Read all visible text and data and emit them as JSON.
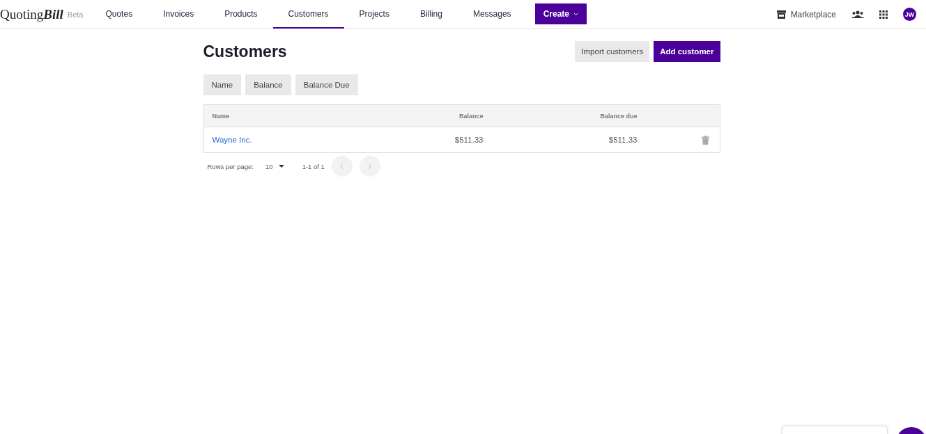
{
  "brand": {
    "name": "Quoting",
    "name_bold": "Bill",
    "badge": "Beta"
  },
  "nav": [
    {
      "label": "Quotes",
      "selected": false
    },
    {
      "label": "Invoices",
      "selected": false
    },
    {
      "label": "Products",
      "selected": false
    },
    {
      "label": "Customers",
      "selected": true
    },
    {
      "label": "Projects",
      "selected": false
    },
    {
      "label": "Billing",
      "selected": false
    },
    {
      "label": "Messages",
      "selected": false
    }
  ],
  "create_button": "Create",
  "marketplace": "Marketplace",
  "avatar": "JW",
  "page_title": "Customers",
  "actions": [
    {
      "label": "Import customers",
      "kind": "secondary"
    },
    {
      "label": "Add customer",
      "kind": "primary"
    }
  ],
  "sort_buttons": [
    "Name",
    "Balance",
    "Balance Due"
  ],
  "table": {
    "columns": [
      "Name",
      "Balance",
      "Balance due"
    ],
    "rows": [
      {
        "name": "Wayne Inc.",
        "balance": "$511.33",
        "balance_due": "$511.33"
      }
    ]
  },
  "pagination": {
    "rows_label": "Rows per page:",
    "rows_value": "10",
    "range": "1-1 of 1"
  }
}
